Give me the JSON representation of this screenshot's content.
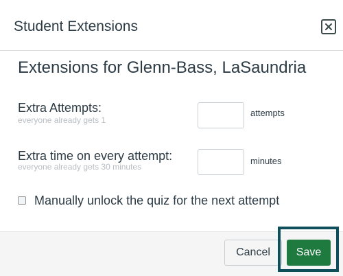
{
  "dialog": {
    "title": "Student Extensions",
    "close_icon": "close-icon"
  },
  "body": {
    "heading": "Extensions for Glenn-Bass, LaSaundria",
    "extra_attempts": {
      "label": "Extra Attempts:",
      "hint": "everyone already gets 1",
      "value": "",
      "unit": "attempts"
    },
    "extra_time": {
      "label": "Extra time on every attempt:",
      "hint": "everyone already gets 30 minutes",
      "value": "",
      "unit": "minutes"
    },
    "manual_unlock": {
      "label": "Manually unlock the quiz for the next attempt",
      "checked": false
    }
  },
  "footer": {
    "cancel_label": "Cancel",
    "save_label": "Save"
  },
  "colors": {
    "save_button": "#1f7a3f",
    "highlight_border": "#0f4f5c",
    "text": "#2d3b45",
    "hint_text": "#b9bec2"
  }
}
